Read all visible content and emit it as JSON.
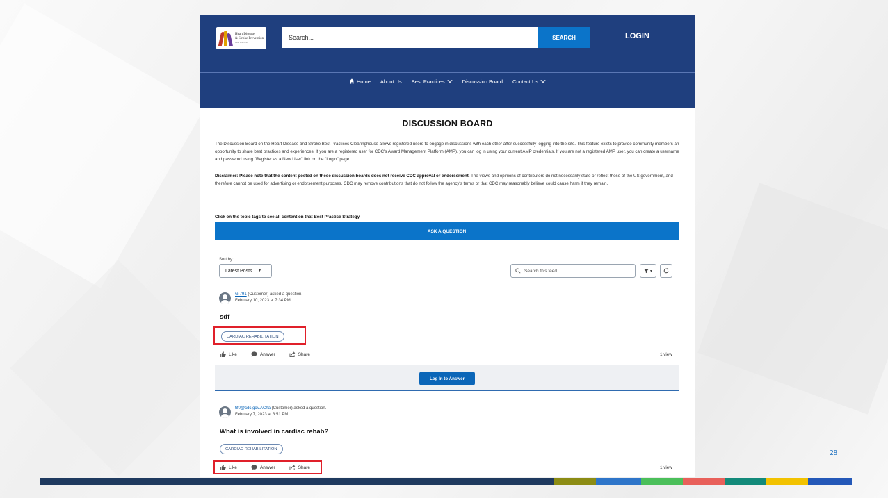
{
  "header": {
    "logo_line1": "Heart Disease",
    "logo_line2": "& Stroke Prevention",
    "logo_tagline": "Best Practices",
    "search_placeholder": "Search...",
    "search_button": "SEARCH",
    "login": "LOGIN"
  },
  "nav": {
    "items": [
      {
        "label": "Home",
        "icon": "home-icon"
      },
      {
        "label": "About Us"
      },
      {
        "label": "Best Practices",
        "icon": "chevron-down-icon"
      },
      {
        "label": "Discussion Board"
      },
      {
        "label": "Contact Us",
        "icon": "chevron-down-icon"
      }
    ]
  },
  "page": {
    "title": "DISCUSSION BOARD",
    "intro": "The Discussion Board on the Heart Disease and Stroke Best Practices Clearinghouse allows registered users to engage in discussions with each other after successfully logging into the site. This feature exists to provide community members an opportunity to share best practices and experiences. If you are a registered user for CDC's Award Management Platform (AMP), you can log in using your current AMP credentials. If you are not a registered AMP user, you can create a username and password using \"Register as a New User\" link on the \"Login\" page.",
    "disclaimer_bold": "Disclaimer: Please note that the content posted on these discussion boards does not receive CDC approval or endorsement.",
    "disclaimer_rest": " The views and opinions of contributors do not necessarily state or reflect those of the US government, and therefore cannot be used for advertising or endorsement purposes. CDC may remove contributions that do not follow the agency's terms or that CDC may reasonably believe could cause harm if they remain.",
    "topic_hint": "Click on the topic tags to see all content on that Best Practice Strategy.",
    "ask_button": "ASK A QUESTION"
  },
  "feed": {
    "sort_label": "Sort by:",
    "sort_value": "Latest Posts",
    "search_placeholder": "Search this feed...",
    "login_to_answer": "Log In to Answer",
    "posts": [
      {
        "author": "G-791",
        "role": " (Customer) asked a question.",
        "date": "February 10, 2023 at 7:34 PM",
        "title": "sdf",
        "tag": "CARDIAC REHABILITATION",
        "like": "Like",
        "answer": "Answer",
        "share": "Share",
        "views": "1 view"
      },
      {
        "author": "tif0@cdc.gov.ACha",
        "role": " (Customer) asked a question.",
        "date": "February 7, 2023 at 3:51 PM",
        "title": "What is involved in cardiac rehab?",
        "tag": "CARDIAC REHABILITATION",
        "like": "Like",
        "answer": "Answer",
        "share": "Share",
        "views": "1 view"
      }
    ]
  },
  "slide": {
    "page_number": "28",
    "bar_colors": [
      "#1f3a5f",
      "#8c8c14",
      "#2e75c9",
      "#4bbf5a",
      "#e8605a",
      "#138a7a",
      "#f2c200",
      "#2458b8"
    ]
  },
  "colors": {
    "header_bg": "#1f3f7e",
    "accent_blue": "#0b74c9",
    "highlight_red": "#e0202a"
  }
}
